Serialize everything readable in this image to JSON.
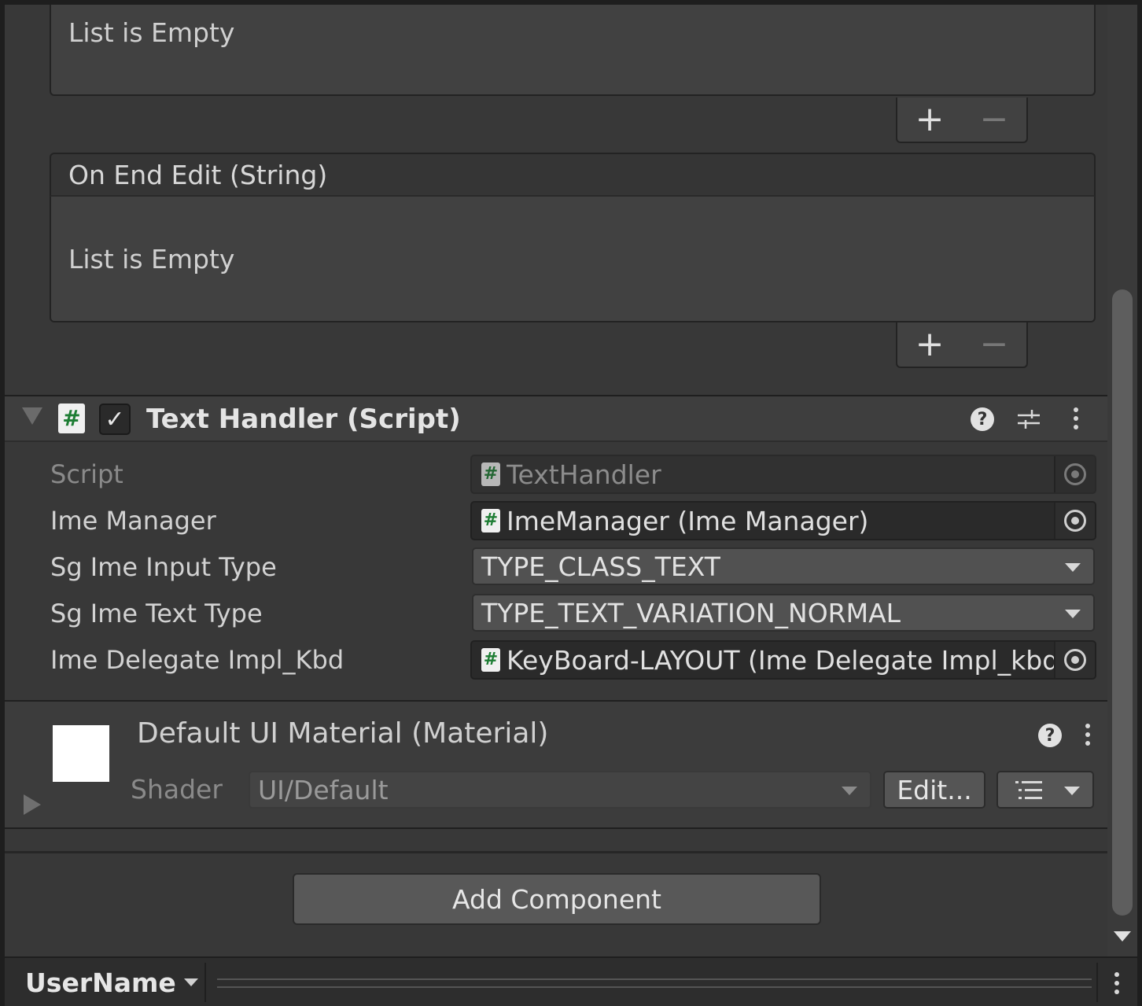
{
  "event_lists": [
    {
      "header": "",
      "empty_text": "List is Empty",
      "add_label": "+",
      "remove_label": "−"
    },
    {
      "header": "On End Edit (String)",
      "empty_text": "List is Empty",
      "add_label": "+",
      "remove_label": "−"
    }
  ],
  "component": {
    "icon_glyph": "#",
    "enabled_glyph": "✓",
    "title": "Text Handler (Script)",
    "help_glyph": "?",
    "properties": {
      "script": {
        "label": "Script",
        "value": "TextHandler"
      },
      "ime_manager": {
        "label": "Ime Manager",
        "value": "ImeManager (Ime Manager)"
      },
      "input_type": {
        "label": "Sg Ime Input Type",
        "value": "TYPE_CLASS_TEXT"
      },
      "text_type": {
        "label": "Sg Ime Text Type",
        "value": "TYPE_TEXT_VARIATION_NORMAL"
      },
      "delegate": {
        "label": "Ime Delegate Impl_Kbd",
        "value": "KeyBoard-LAYOUT (Ime Delegate Impl_kbd)"
      }
    }
  },
  "material": {
    "title": "Default UI Material (Material)",
    "help_glyph": "?",
    "shader_label": "Shader",
    "shader_value": "UI/Default",
    "edit_label": "Edit..."
  },
  "add_component_label": "Add Component",
  "bottom_bar": {
    "user_label": "UserName"
  },
  "colors": {
    "panel_bg": "#383838",
    "script_icon_green": "#1e7d34",
    "material_preview": "#ffffff"
  }
}
